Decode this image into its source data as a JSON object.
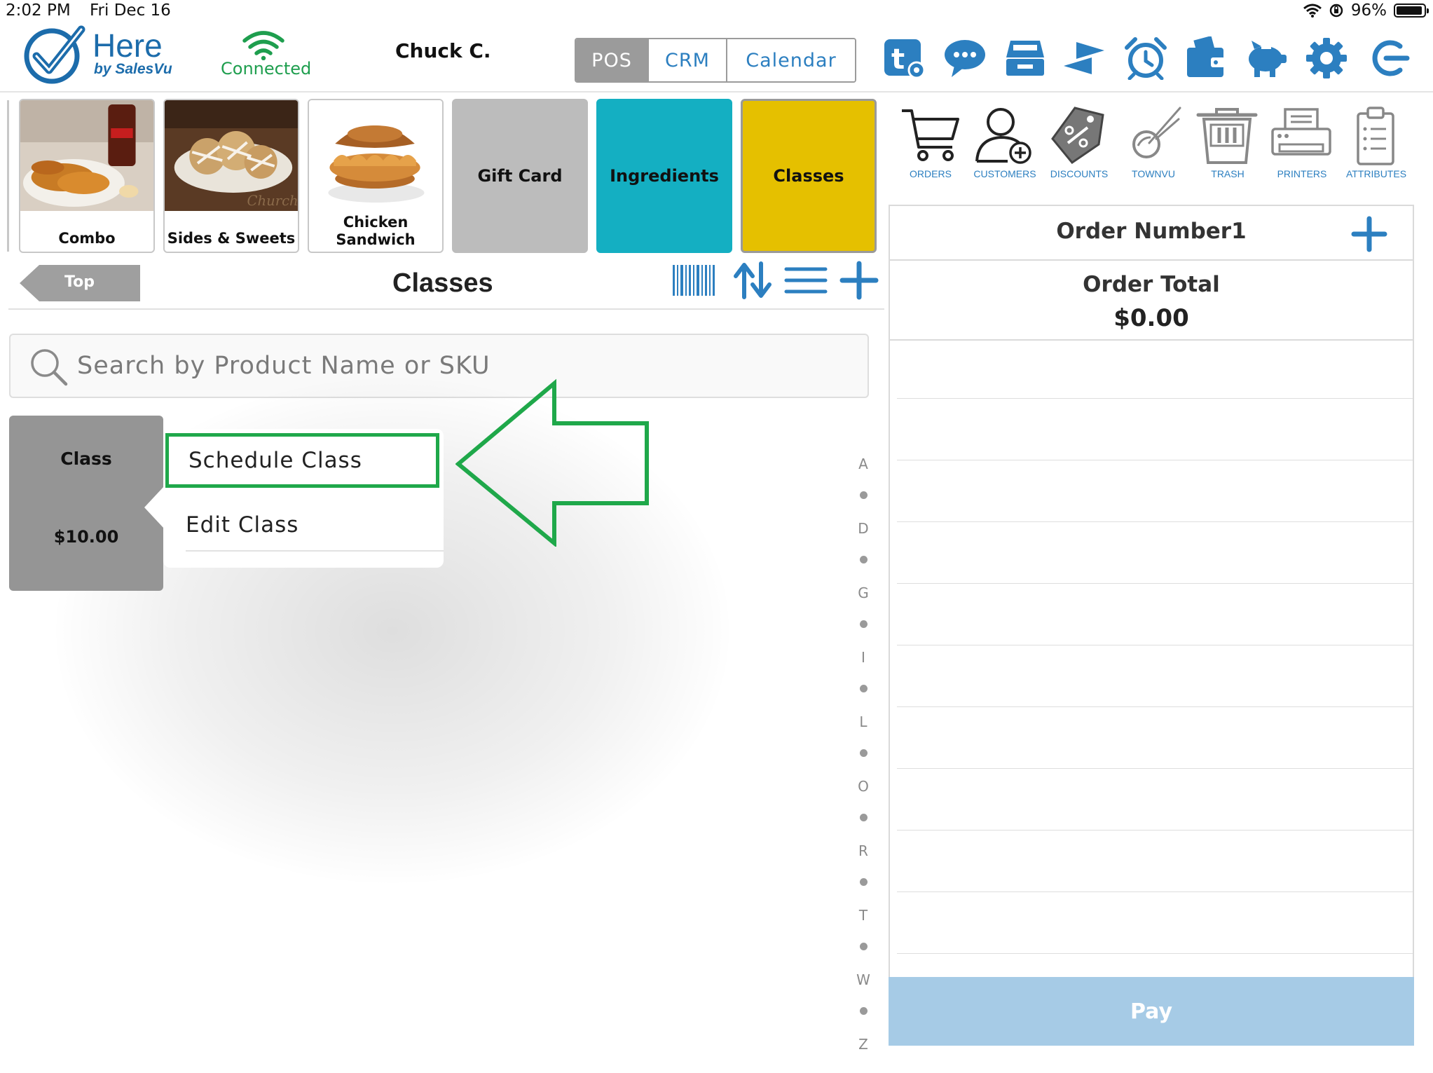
{
  "status_bar": {
    "time": "2:02 PM",
    "date": "Fri Dec 16",
    "battery": "96%",
    "battery_level": 0.96
  },
  "header": {
    "logo_title": "Here",
    "logo_subtitle": "by SalesVu",
    "connection_status": "Connected",
    "user_name": "Chuck C.",
    "mode_tabs": [
      {
        "label": "POS",
        "active": true
      },
      {
        "label": "CRM",
        "active": false
      },
      {
        "label": "Calendar",
        "active": false
      }
    ],
    "icons": [
      "tasks-settings-icon",
      "chat-icon",
      "cash-drawer-icon",
      "transfer-arrows-icon",
      "alarm-clock-icon",
      "wallet-icon",
      "piggy-bank-icon",
      "gear-icon",
      "logout-icon"
    ]
  },
  "categories": [
    {
      "label": "Combo",
      "type": "image"
    },
    {
      "label": "Sides & Sweets",
      "type": "image"
    },
    {
      "label": "Chicken Sandwich",
      "type": "image"
    },
    {
      "label": "Gift Card",
      "type": "solid",
      "color": "#bcbcbc"
    },
    {
      "label": "Ingredients",
      "type": "solid",
      "color": "#14afc2"
    },
    {
      "label": "Classes",
      "type": "solid",
      "color": "#e5c000"
    }
  ],
  "navigation": {
    "back_label": "Top",
    "section_title": "Classes",
    "tools": [
      "barcode-icon",
      "sort-icon",
      "list-icon",
      "add-icon"
    ]
  },
  "search": {
    "placeholder": "Search by Product Name or SKU"
  },
  "product": {
    "name": "Class",
    "price": "$10.00"
  },
  "context_menu": {
    "items": [
      "Schedule Class",
      "Edit Class"
    ]
  },
  "alpha_index": [
    "A",
    "D",
    "G",
    "I",
    "L",
    "O",
    "R",
    "T",
    "W",
    "Z"
  ],
  "right_toolbar": [
    {
      "label": "ORDERS",
      "icon": "cart-icon"
    },
    {
      "label": "CUSTOMERS",
      "icon": "add-customer-icon"
    },
    {
      "label": "DISCOUNTS",
      "icon": "discount-tag-icon"
    },
    {
      "label": "TOWNVU",
      "icon": "townvu-icon"
    },
    {
      "label": "TRASH",
      "icon": "trash-icon"
    },
    {
      "label": "PRINTERS",
      "icon": "printer-icon"
    },
    {
      "label": "ATTRIBUTES",
      "icon": "clipboard-icon"
    }
  ],
  "order": {
    "title": "Order Number1",
    "total_label": "Order Total",
    "total_value": "$0.00",
    "pay_label": "Pay"
  },
  "colors": {
    "brand_blue": "#2c7fc0",
    "connected_green": "#1e9e4e",
    "highlight_green": "#1fa84a",
    "pay_button": "#a6cbe6"
  }
}
